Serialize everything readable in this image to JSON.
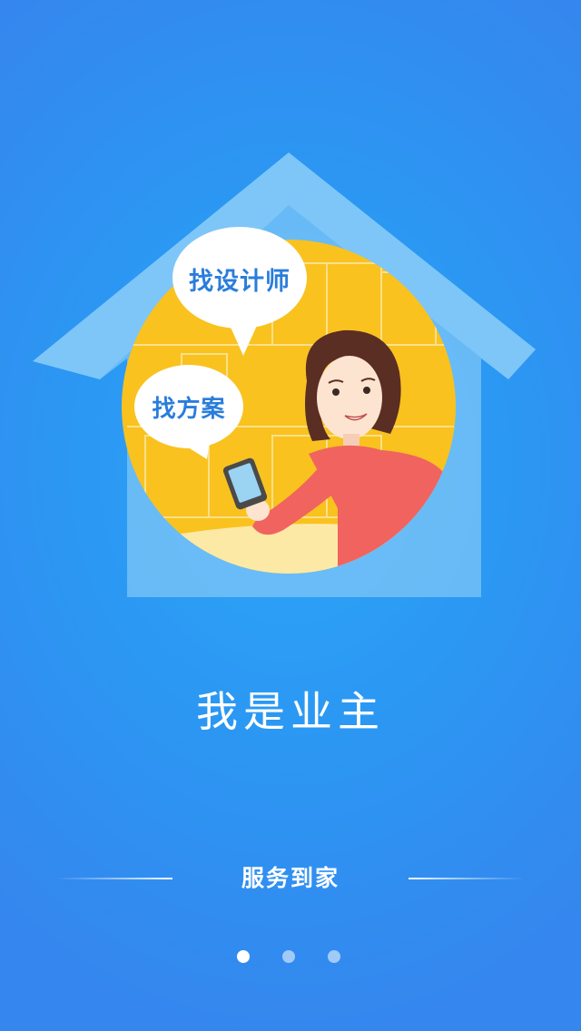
{
  "illustration": {
    "bubble_find_designer": "找设计师",
    "bubble_find_plan": "找方案"
  },
  "headline": "我是业主",
  "tagline": "服务到家",
  "pager": {
    "total": 3,
    "active_index": 1
  },
  "colors": {
    "background_top": "#2ea6f7",
    "background_bottom": "#3586ee",
    "house_fill": "#7ec6f7",
    "circle_fill": "#f9c21f",
    "shirt": "#f0635f",
    "bubble_text": "#2a7ddb"
  }
}
